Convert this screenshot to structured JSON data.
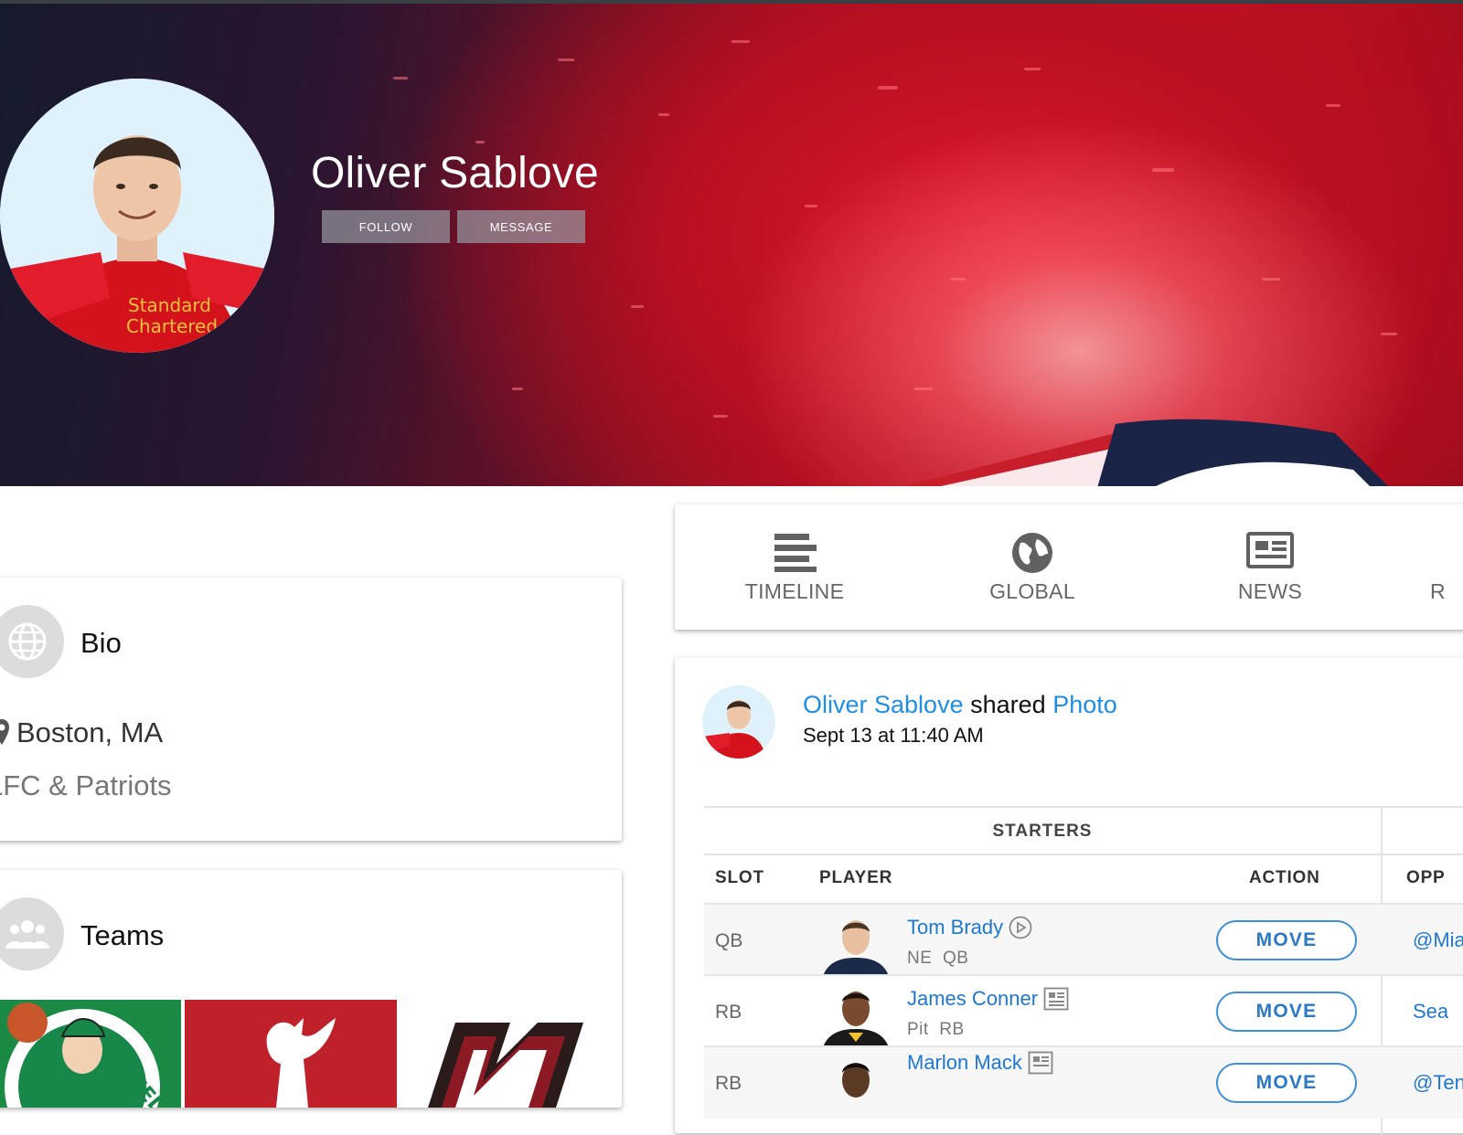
{
  "profile": {
    "name": "Oliver Sablove",
    "follow_label": "FOLLOW",
    "message_label": "MESSAGE",
    "avatar_icon": "profile-photo"
  },
  "bio": {
    "title": "Bio",
    "location": "Boston, MA",
    "description": "LFC & Patriots"
  },
  "teams": {
    "title": "Teams",
    "logos": [
      "celtics-logo",
      "liverpool-logo",
      "team-logo"
    ]
  },
  "tabs": [
    {
      "label": "TIMELINE",
      "icon": "timeline-icon"
    },
    {
      "label": "GLOBAL",
      "icon": "globe-icon"
    },
    {
      "label": "NEWS",
      "icon": "newspaper-icon"
    },
    {
      "label": "R",
      "icon": ""
    }
  ],
  "post": {
    "author": "Oliver Sablove",
    "action": "shared",
    "object": "Photo",
    "timestamp": "Sept 13 at 11:40 AM"
  },
  "roster": {
    "group_label": "STARTERS",
    "columns": [
      "SLOT",
      "PLAYER",
      "ACTION",
      "OPP"
    ],
    "rows": [
      {
        "slot": "QB",
        "name": "Tom Brady",
        "team": "NE",
        "pos": "QB",
        "action": "MOVE",
        "opp": "@Mia",
        "badge": "play-icon"
      },
      {
        "slot": "RB",
        "name": "James Conner",
        "team": "Pit",
        "pos": "RB",
        "action": "MOVE",
        "opp": "Sea",
        "badge": "news-icon"
      },
      {
        "slot": "RB",
        "name": "Marlon Mack",
        "team": "",
        "pos": "",
        "action": "MOVE",
        "opp": "@Ten",
        "badge": "news-icon"
      }
    ]
  },
  "colors": {
    "link": "#1e8ee6",
    "button_border": "#3d8fd6",
    "cover_red": "#c6121f",
    "cover_navy": "#1a2446"
  }
}
